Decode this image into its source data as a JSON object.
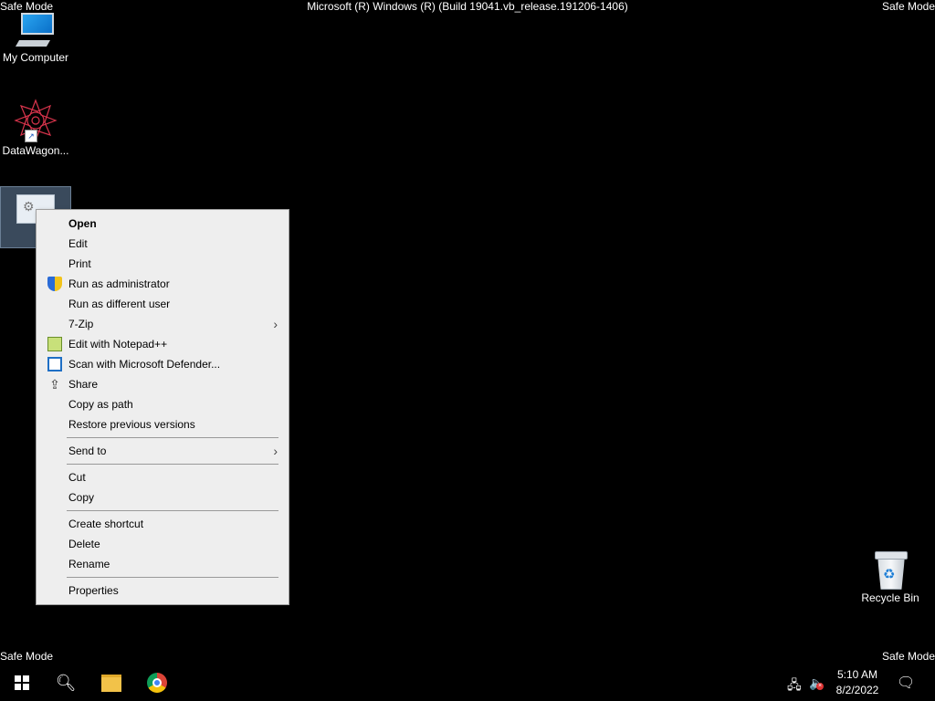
{
  "screen": {
    "safe_mode": "Safe Mode",
    "build_title": "Microsoft (R) Windows (R) (Build 19041.vb_release.191206-1406)"
  },
  "desktop": {
    "icons": [
      {
        "label": "My Computer",
        "icon": "computer-icon"
      },
      {
        "label": "DataWagon...",
        "icon": "datawagon-icon"
      },
      {
        "label": "",
        "icon": "settings-file-icon"
      },
      {
        "label": "Recycle Bin",
        "icon": "recycle-bin-icon"
      }
    ]
  },
  "context_menu": {
    "items": [
      {
        "label": "Open",
        "bold": true
      },
      {
        "label": "Edit"
      },
      {
        "label": "Print"
      },
      {
        "label": "Run as administrator",
        "icon": "uac-shield-icon"
      },
      {
        "label": "Run as different user"
      },
      {
        "label": "7-Zip",
        "submenu": true
      },
      {
        "label": "Edit with Notepad++",
        "icon": "notepad-plus-plus-icon"
      },
      {
        "label": "Scan with Microsoft Defender...",
        "icon": "defender-icon"
      },
      {
        "label": "Share",
        "icon": "share-icon"
      },
      {
        "label": "Copy as path"
      },
      {
        "label": "Restore previous versions"
      },
      {
        "label": "Send to",
        "submenu": true
      },
      {
        "label": "Cut"
      },
      {
        "label": "Copy"
      },
      {
        "label": "Create shortcut"
      },
      {
        "label": "Delete"
      },
      {
        "label": "Rename"
      },
      {
        "label": "Properties"
      }
    ],
    "submenu_arrow": "›"
  },
  "taskbar": {
    "apps": [
      "start-icon",
      "search-icon",
      "file-explorer-icon",
      "chrome-icon"
    ],
    "time": "5:10 AM",
    "date": "8/2/2022",
    "tray": [
      "network-icon",
      "volume-muted-icon",
      "notification-icon"
    ]
  }
}
